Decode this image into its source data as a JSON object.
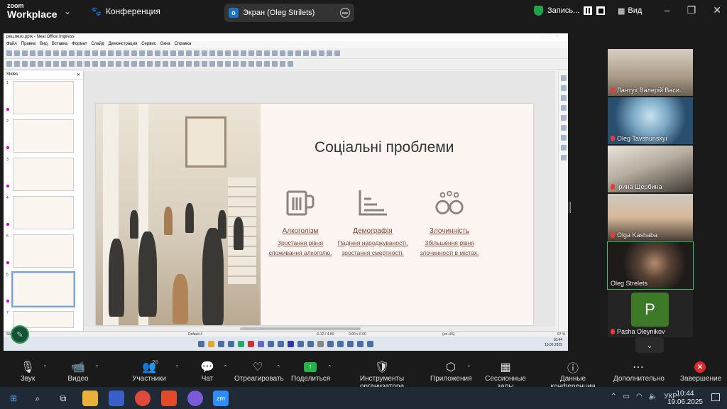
{
  "app": {
    "logo_top": "zoom",
    "logo_bottom": "Workplace",
    "meeting": "Конференция"
  },
  "share_tab": {
    "label": "Экран (Oleg Strilets)",
    "icon": "o"
  },
  "recording": {
    "label": "Запись..."
  },
  "view": {
    "label": "Вид"
  },
  "impress": {
    "title": "рец.пезо.pptx - Neat Office Impress",
    "menu": [
      "Файл",
      "Правка",
      "Вид",
      "Вставка",
      "Формат",
      "Слайд",
      "Демонстрация",
      "Сервис",
      "Окна",
      "Справка"
    ],
    "slides_panel_title": "Slides",
    "slide_numbers": [
      "1",
      "2",
      "3",
      "4",
      "5",
      "6",
      "7"
    ],
    "status": {
      "slide": "Slide 6 of 7",
      "layout": "Default 4",
      "pos": "-0.12 / 4.00",
      "size": "0.00 x 0.00",
      "lang": "(en-US)",
      "zoom": "97 %"
    },
    "clock": {
      "time": "10:44",
      "date": "19.06.2025"
    }
  },
  "slide": {
    "title": "Соціальні проблеми",
    "columns": [
      {
        "heading": "Алкоголізм",
        "text": "Зростання рівня споживання алкоголю.",
        "icon": "mug-icon"
      },
      {
        "heading": "Демографія",
        "text": "Падіння народжуваності, зростання смертності.",
        "icon": "chart-icon"
      },
      {
        "heading": "Злочинність",
        "text": "Збільшення рівня злочинності в містах.",
        "icon": "handcuffs-icon"
      }
    ]
  },
  "participants_tiles": [
    {
      "name": "Лантух Валерій Васи...",
      "muted": true
    },
    {
      "name": "Oleg Tavshunskyi",
      "muted": true
    },
    {
      "name": "Ірина Щербина",
      "muted": true
    },
    {
      "name": "Olga Kashaba",
      "muted": true
    },
    {
      "name": "Oleg Strelets",
      "muted": false,
      "active": true
    },
    {
      "name": "Pasha Oleynikov",
      "muted": true,
      "initial": "P"
    }
  ],
  "controls": {
    "audio": "Звук",
    "video": "Видео",
    "participants": "Участники",
    "participants_count": "26",
    "chat": "Чат",
    "react": "Отреагировать",
    "share": "Поделиться",
    "host_tools": "Инструменты организатора",
    "apps": "Приложения",
    "rooms": "Сессионные залы",
    "info": "Данные конференции",
    "more": "Дополнительно",
    "end": "Завершение"
  },
  "taskbar": {
    "lang": "УКР",
    "time": "10:44",
    "date": "19.06.2025"
  }
}
